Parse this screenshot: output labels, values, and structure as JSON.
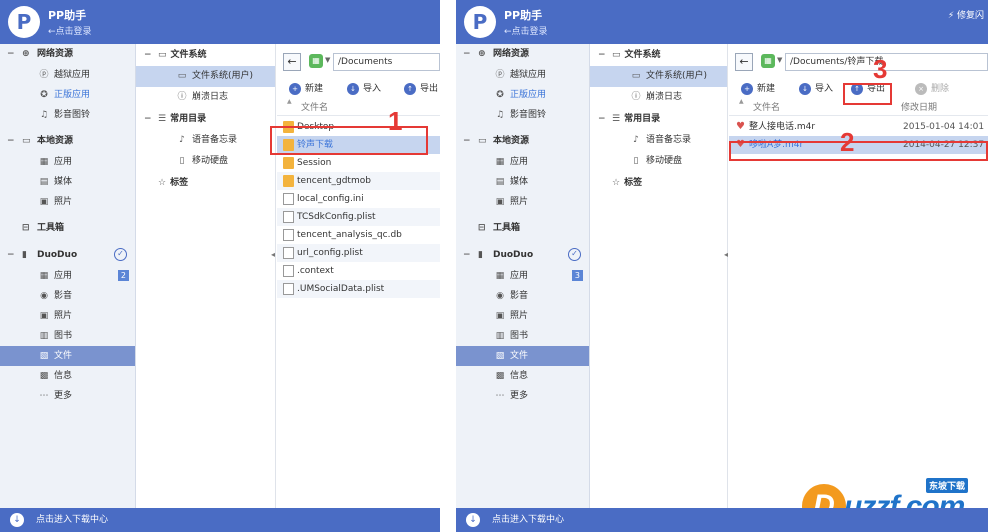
{
  "app": {
    "title": "PP助手",
    "login": "←点击登录",
    "repair": "⚡ 修复闪"
  },
  "nav": {
    "net_resources": "网络资源",
    "jailbreak_apps": "越狱应用",
    "official_apps": "正版应用",
    "ringtones": "影音图铃",
    "local_resources": "本地资源",
    "apps": "应用",
    "media": "媒体",
    "photos": "照片",
    "toolbox": "工具箱",
    "device": "DuoDuo",
    "dev_apps": "应用",
    "dev_apps_badge_left": "2",
    "dev_apps_badge_right": "3",
    "dev_video": "影音",
    "dev_photos": "照片",
    "dev_books": "图书",
    "dev_files": "文件",
    "dev_info": "信息",
    "dev_more": "更多"
  },
  "footer": {
    "download_center": "点击进入下载中心"
  },
  "tree": {
    "filesystem": "文件系统",
    "filesystem_user": "文件系统(用户)",
    "crash_log": "崩溃日志",
    "common_dirs": "常用目录",
    "voice_memos": "语音备忘录",
    "mobile_disk": "移动硬盘",
    "tags": "标签"
  },
  "left": {
    "path": "/Documents",
    "toolbar": {
      "new": "新建",
      "import": "导入",
      "export": "导出"
    },
    "col_name": "文件名",
    "files": [
      {
        "name": "Desktop",
        "type": "folder"
      },
      {
        "name": "铃声下载",
        "type": "folder"
      },
      {
        "name": "Session",
        "type": "folder"
      },
      {
        "name": "tencent_gdtmob",
        "type": "folder"
      },
      {
        "name": "local_config.ini",
        "type": "file"
      },
      {
        "name": "TCSdkConfig.plist",
        "type": "file"
      },
      {
        "name": "tencent_analysis_qc.db",
        "type": "file"
      },
      {
        "name": "url_config.plist",
        "type": "file"
      },
      {
        "name": ".context",
        "type": "file"
      },
      {
        "name": ".UMSocialData.plist",
        "type": "file"
      }
    ],
    "step": "1"
  },
  "right": {
    "path": "/Documents/铃声下载",
    "toolbar": {
      "new": "新建",
      "import": "导入",
      "export": "导出",
      "delete": "删除"
    },
    "col_name": "文件名",
    "col_date": "修改日期",
    "files": [
      {
        "name": "整人接电话.m4r",
        "date": "2015-01-04 14:01"
      },
      {
        "name": "哆啦A梦.m4r",
        "date": "2014-04-27 12:37"
      }
    ],
    "step2": "2",
    "step3": "3"
  },
  "watermark": {
    "logo": "D",
    "brand": "uzzf.com",
    "slogan": "东坡下载"
  },
  "colors": {
    "header": "#4a6cc4",
    "selected": "#7a93cf",
    "highlight": "#c6d5ef",
    "annotation": "#e53935"
  }
}
